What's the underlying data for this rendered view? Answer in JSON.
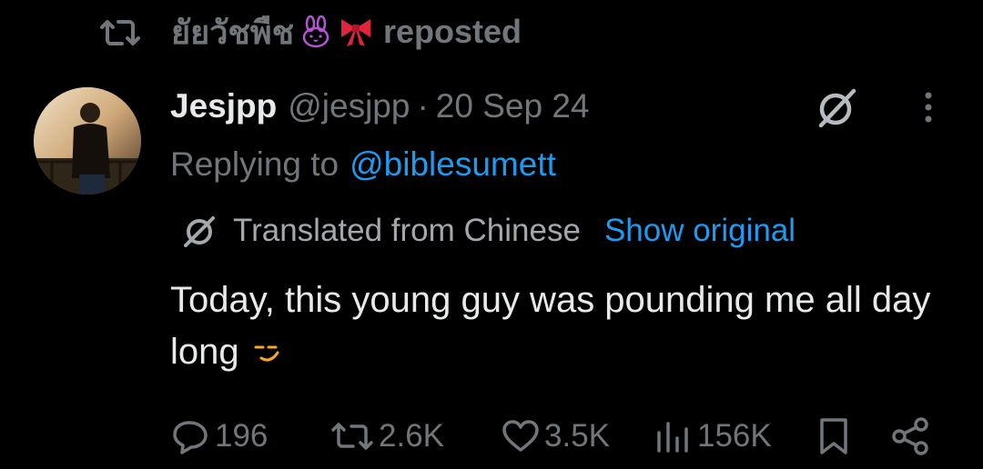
{
  "repost": {
    "user": "ยัยวัชพืช",
    "emojis": [
      "rabbit-emoji",
      "ribbon-emoji"
    ],
    "label": "reposted"
  },
  "tweet": {
    "display_name": "Jesjpp",
    "handle": "@jesjpp",
    "separator": "·",
    "date": "20 Sep 24",
    "replying_prefix": "Replying to",
    "replying_to": "@biblesumett",
    "translated_label": "Translated from Chinese",
    "show_original": "Show original",
    "text": "Today, this young guy was pounding me all day long"
  },
  "actions": {
    "replies": "196",
    "reposts": "2.6K",
    "likes": "3.5K",
    "views": "156K"
  },
  "icons": {
    "repost": "repost-icon",
    "grok": "grok-icon",
    "more": "more-options-icon",
    "translate": "translate-icon",
    "reply": "reply-icon",
    "like": "heart-icon",
    "views": "views-chart-icon",
    "bookmark": "bookmark-icon",
    "share": "share-icon"
  },
  "colors": {
    "background": "#000000",
    "primary_text": "#e7e9ea",
    "secondary_text": "#71767b",
    "link": "#1d9bf0"
  }
}
